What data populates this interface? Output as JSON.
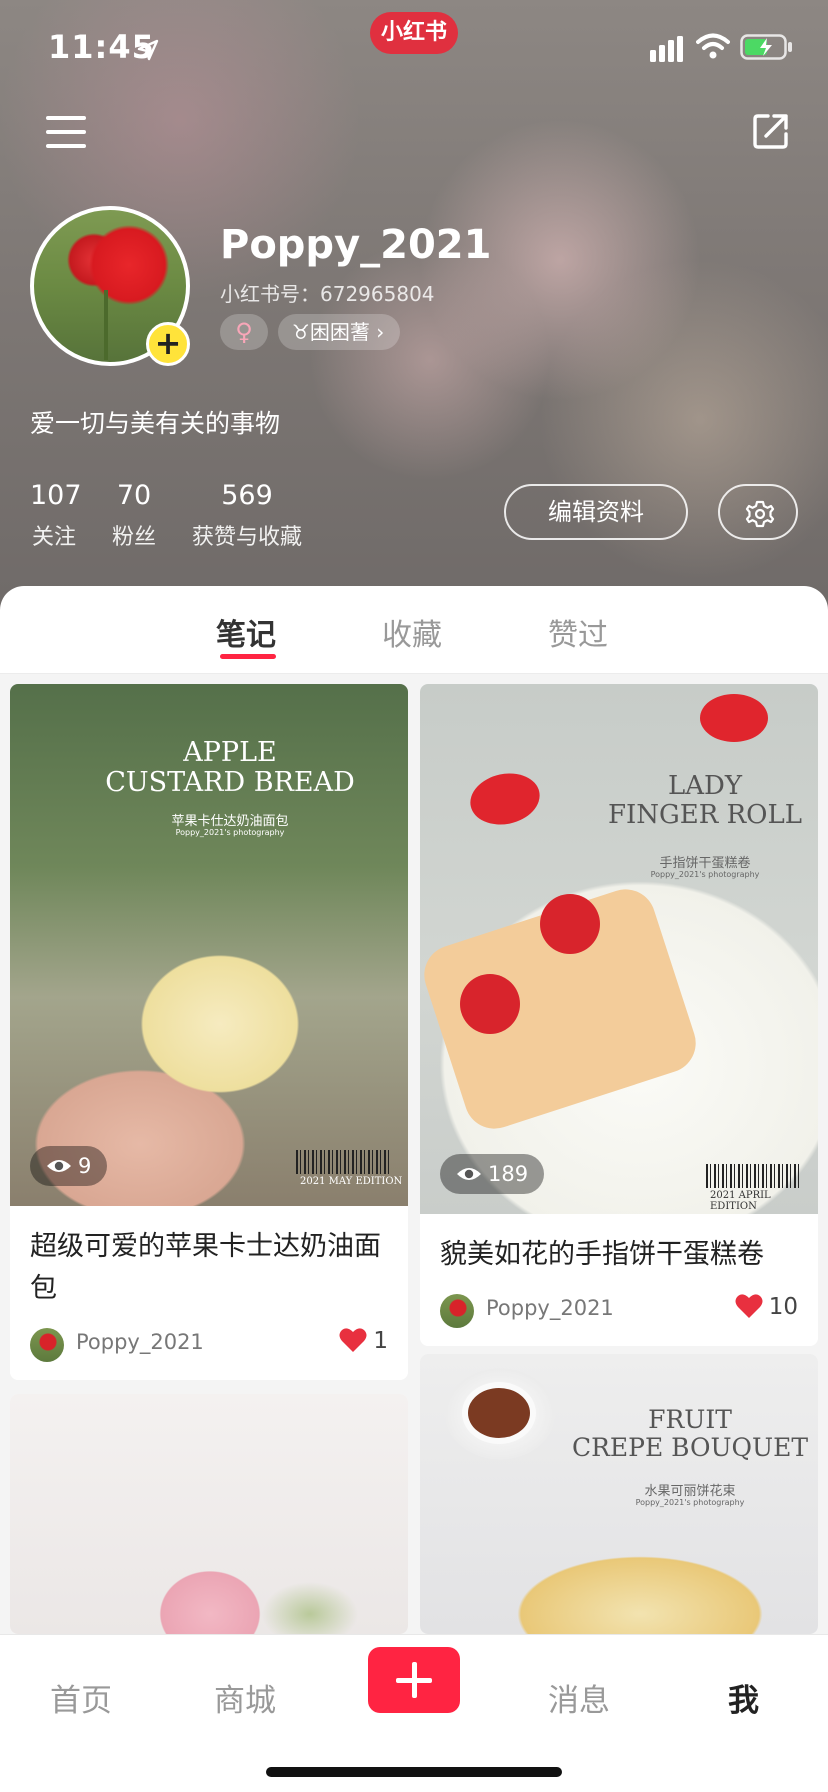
{
  "status_bar": {
    "time": "11:45",
    "app_badge": "小红书"
  },
  "profile": {
    "username": "Poppy_2021",
    "redbook_id": "小红书号：672965804",
    "gender_symbol": "♀",
    "zodiac": "♉困困蓍 ›",
    "bio": "爱一切与美有关的事物",
    "add_symbol": "+",
    "stats": [
      {
        "value": "107",
        "label": "关注"
      },
      {
        "value": "70",
        "label": "粉丝"
      },
      {
        "value": "569",
        "label": "获赞与收藏"
      }
    ],
    "edit_label": "编辑资料"
  },
  "tabs": [
    {
      "label": "笔记",
      "active": true
    },
    {
      "label": "收藏",
      "active": false
    },
    {
      "label": "赞过",
      "active": false
    }
  ],
  "feed": [
    {
      "title": "超级可爱的苹果卡士达奶油面包",
      "views": "9",
      "author": "Poppy_2021",
      "likes": "1",
      "poster_title": "APPLE\nCUSTARD BREAD",
      "poster_sub": "苹果卡仕达奶油面包",
      "poster_credit": "Poppy_2021's photography",
      "edition": "2021 MAY EDITION"
    },
    {
      "title": "貌美如花的手指饼干蛋糕卷",
      "views": "189",
      "author": "Poppy_2021",
      "likes": "10",
      "poster_title": "LADY\nFINGER ROLL",
      "poster_sub": "手指饼干蛋糕卷",
      "poster_credit": "Poppy_2021's photography",
      "edition": "2021 APRIL EDITION"
    },
    {
      "poster_title": "FRUIT\nCREPE BOUQUET",
      "poster_sub": "水果可丽饼花束",
      "poster_credit": "Poppy_2021's photography"
    }
  ],
  "bottom_nav": [
    {
      "label": "首页",
      "active": false
    },
    {
      "label": "商城",
      "active": false
    },
    {
      "label": "消息",
      "active": false
    },
    {
      "label": "我",
      "active": true
    }
  ],
  "icons": {
    "menu": "hamburger-icon",
    "share": "share-out-icon",
    "settings": "gear-icon",
    "views": "eye-icon",
    "likes": "heart-icon",
    "publish": "plus-icon"
  },
  "colors": {
    "brand_red": "#ff2442",
    "badge_red": "#e0303f",
    "add_yellow": "#ffe33a",
    "heart_red": "#e8303f"
  }
}
